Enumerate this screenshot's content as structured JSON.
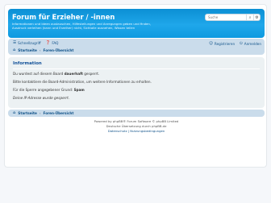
{
  "header": {
    "title": "Forum für Erzieher / -innen",
    "description": "Informationen und Ideen austauschen, Hilfestellungen und Anregungen geben und finden, Ausdruck verleihen (kann und Erzeiher) nicht, Sichtalle ausnehen, Wissen teilen"
  },
  "search": {
    "placeholder": "Suche",
    "submit_icon": "search-icon",
    "advanced_icon": "gear-icon"
  },
  "nav": {
    "quicklinks_label": "Schnellzugriff",
    "faq_label": "FAQ",
    "register_label": "Registrieren",
    "login_label": "Anmelden"
  },
  "breadcrumbs": {
    "home": "Startseite",
    "separator": "‹",
    "index": "Foren-Übersicht"
  },
  "info": {
    "title": "Information",
    "line1_prefix": "Du wurdest auf diesem Board ",
    "line1_bold": "dauerhaft",
    "line1_suffix": " gesperrt.",
    "line2": "Bitte kontaktiere die Board-Administration, um weitere Informationen zu erhalten.",
    "line3_prefix": "Für die Sperre angegebener Grund: ",
    "line3_bold": "Spam",
    "line4": "Deine IP-Adresse wurde gesperrt."
  },
  "footer": {
    "powered": "Powered by phpBB® Forum Software © phpBB Limited",
    "translation": "Deutsche Übersetzung durch phpBB.de",
    "links": "Datenschutz | Nutzungsbedingungen"
  },
  "colors": {
    "header": "#12a3eb",
    "navbar": "#cadceb",
    "panel": "#ecf1f3",
    "link": "#105289"
  }
}
